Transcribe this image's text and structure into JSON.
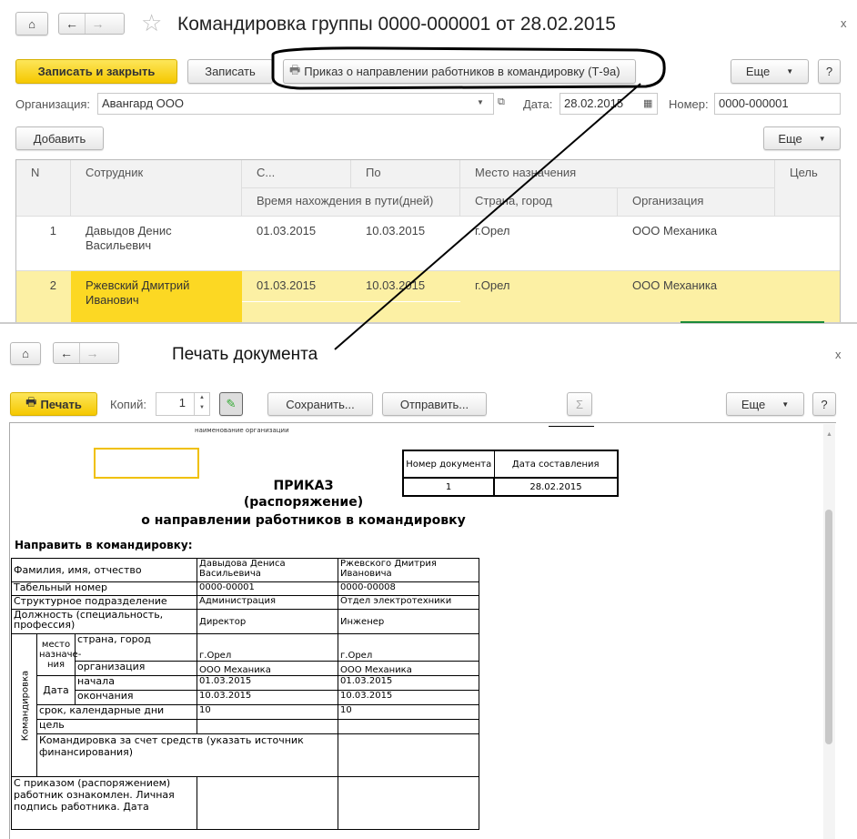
{
  "top": {
    "title": "Командировка группы 0000-000001 от 28.02.2015",
    "save_close": "Записать и закрыть",
    "save": "Записать",
    "print_cmd": "Приказ о направлении работников в командировку (Т-9а)",
    "more": "Еще",
    "help": "?",
    "close": "x",
    "org_label": "Организация:",
    "org_value": "Авангард ООО",
    "date_label": "Дата:",
    "date_value": "28.02.2015",
    "num_label": "Номер:",
    "num_value": "0000-000001",
    "add": "Добавить",
    "more2": "Еще",
    "columns": {
      "n": "N",
      "employee": "Сотрудник",
      "from": "С...",
      "to": "По",
      "dest": "Место назначения",
      "goal": "Цель",
      "travel": "Время нахождения в пути(дней)",
      "city": "Страна, город",
      "org": "Организация"
    },
    "rows": [
      {
        "n": "1",
        "employee": "Давыдов Денис Васильевич",
        "from": "01.03.2015",
        "to": "10.03.2015",
        "city": "г.Орел",
        "org": "ООО Механика"
      },
      {
        "n": "2",
        "employee": "Ржевский Дмитрий Иванович",
        "from": "01.03.2015",
        "to": "10.03.2015",
        "city": "г.Орел",
        "org": "ООО Механика"
      }
    ]
  },
  "print": {
    "title": "Печать документа",
    "close": "x",
    "print": "Печать",
    "copies_label": "Копий:",
    "copies": "1",
    "save": "Сохранить...",
    "send": "Отправить...",
    "sum": "Σ",
    "more": "Еще",
    "help": "?"
  },
  "doc": {
    "org_caption": "наименование организации",
    "doc_num_label": "Номер документа",
    "doc_date_label": "Дата составления",
    "doc_num": "1",
    "doc_date": "28.02.2015",
    "title1": "ПРИКАЗ",
    "title2": "(распоряжение)",
    "title3": "о направлении работников в командировку",
    "send_label": "Направить в командировку:",
    "r_fio": "Фамилия, имя, отчество",
    "r_tab": "Табельный номер",
    "r_dept": "Структурное подразделение",
    "r_pos": "Должность (специальность, профессия)",
    "r_trip": "Командировка",
    "r_place": "место назначе-ния",
    "r_city": "страна, город",
    "r_org": "организация",
    "r_date": "Дата",
    "r_start": "начала",
    "r_end": "окончания",
    "r_days": "срок, календарные дни",
    "r_goal": "цель",
    "r_fund": "Командировка за счет средств (указать источник финансирования)",
    "r_sign": "С приказом (распоряжением) работник ознакомлен. Личная подпись работника. Дата",
    "emp": [
      {
        "fio": "Давыдова Дениса Васильевича",
        "tab": "0000-00001",
        "dept": "Администрация",
        "pos": "Директор",
        "city": "г.Орел",
        "org": "ООО Механика",
        "start": "01.03.2015",
        "end": "10.03.2015",
        "days": "10"
      },
      {
        "fio": "Ржевского Дмитрия Ивановича",
        "tab": "0000-00008",
        "dept": "Отдел электротехники",
        "pos": "Инженер",
        "city": "г.Орел",
        "org": "ООО Механика",
        "start": "01.03.2015",
        "end": "10.03.2015",
        "days": "10"
      }
    ]
  }
}
